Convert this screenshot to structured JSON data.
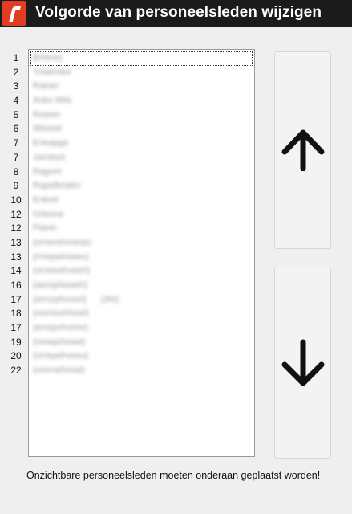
{
  "window": {
    "title": "Volgorde van personeelsleden wijzigen",
    "icon": "app-logo-icon",
    "icon_color": "#e03d22"
  },
  "staff_list": {
    "items": [
      {
        "number": "1",
        "name": "Brittney"
      },
      {
        "number": "2",
        "name": "Tristenlee"
      },
      {
        "number": "3",
        "name": "Rainer"
      },
      {
        "number": "4",
        "name": "Anko Mile"
      },
      {
        "number": "5",
        "name": "Rowen"
      },
      {
        "number": "6",
        "name": "Wessel"
      },
      {
        "number": "7",
        "name": "Eneapge"
      },
      {
        "number": "7",
        "name": "Jamleys"
      },
      {
        "number": "8",
        "name": "Ragnnt"
      },
      {
        "number": "9",
        "name": "Rapidbriabn"
      },
      {
        "number": "10",
        "name": "Enkret"
      },
      {
        "number": "12",
        "name": "Orlesne"
      },
      {
        "number": "12",
        "name": "Pianic"
      },
      {
        "number": "13",
        "name": "(ornerehvoear)"
      },
      {
        "number": "13",
        "name": "(rrnepehoeeu)"
      },
      {
        "number": "14",
        "name": "(orveoehveerl)"
      },
      {
        "number": "16",
        "name": "(aerepheweh)"
      },
      {
        "number": "17",
        "name": "(errurphvoorl)",
        "extra": "(3ht)"
      },
      {
        "number": "18",
        "name": "(oomouhhowl)"
      },
      {
        "number": "17",
        "name": "(errepohveov)"
      },
      {
        "number": "19",
        "name": "(nnreprhrewl)"
      },
      {
        "number": "20",
        "name": "(orrepehveeu)"
      },
      {
        "number": "22",
        "name": "(omrnehrewl)"
      }
    ]
  },
  "buttons": {
    "up": {
      "icon": "arrow-up-icon"
    },
    "down": {
      "icon": "arrow-down-icon"
    }
  },
  "footer": {
    "note": "Onzichtbare personeelsleden moeten onderaan geplaatst worden!"
  }
}
